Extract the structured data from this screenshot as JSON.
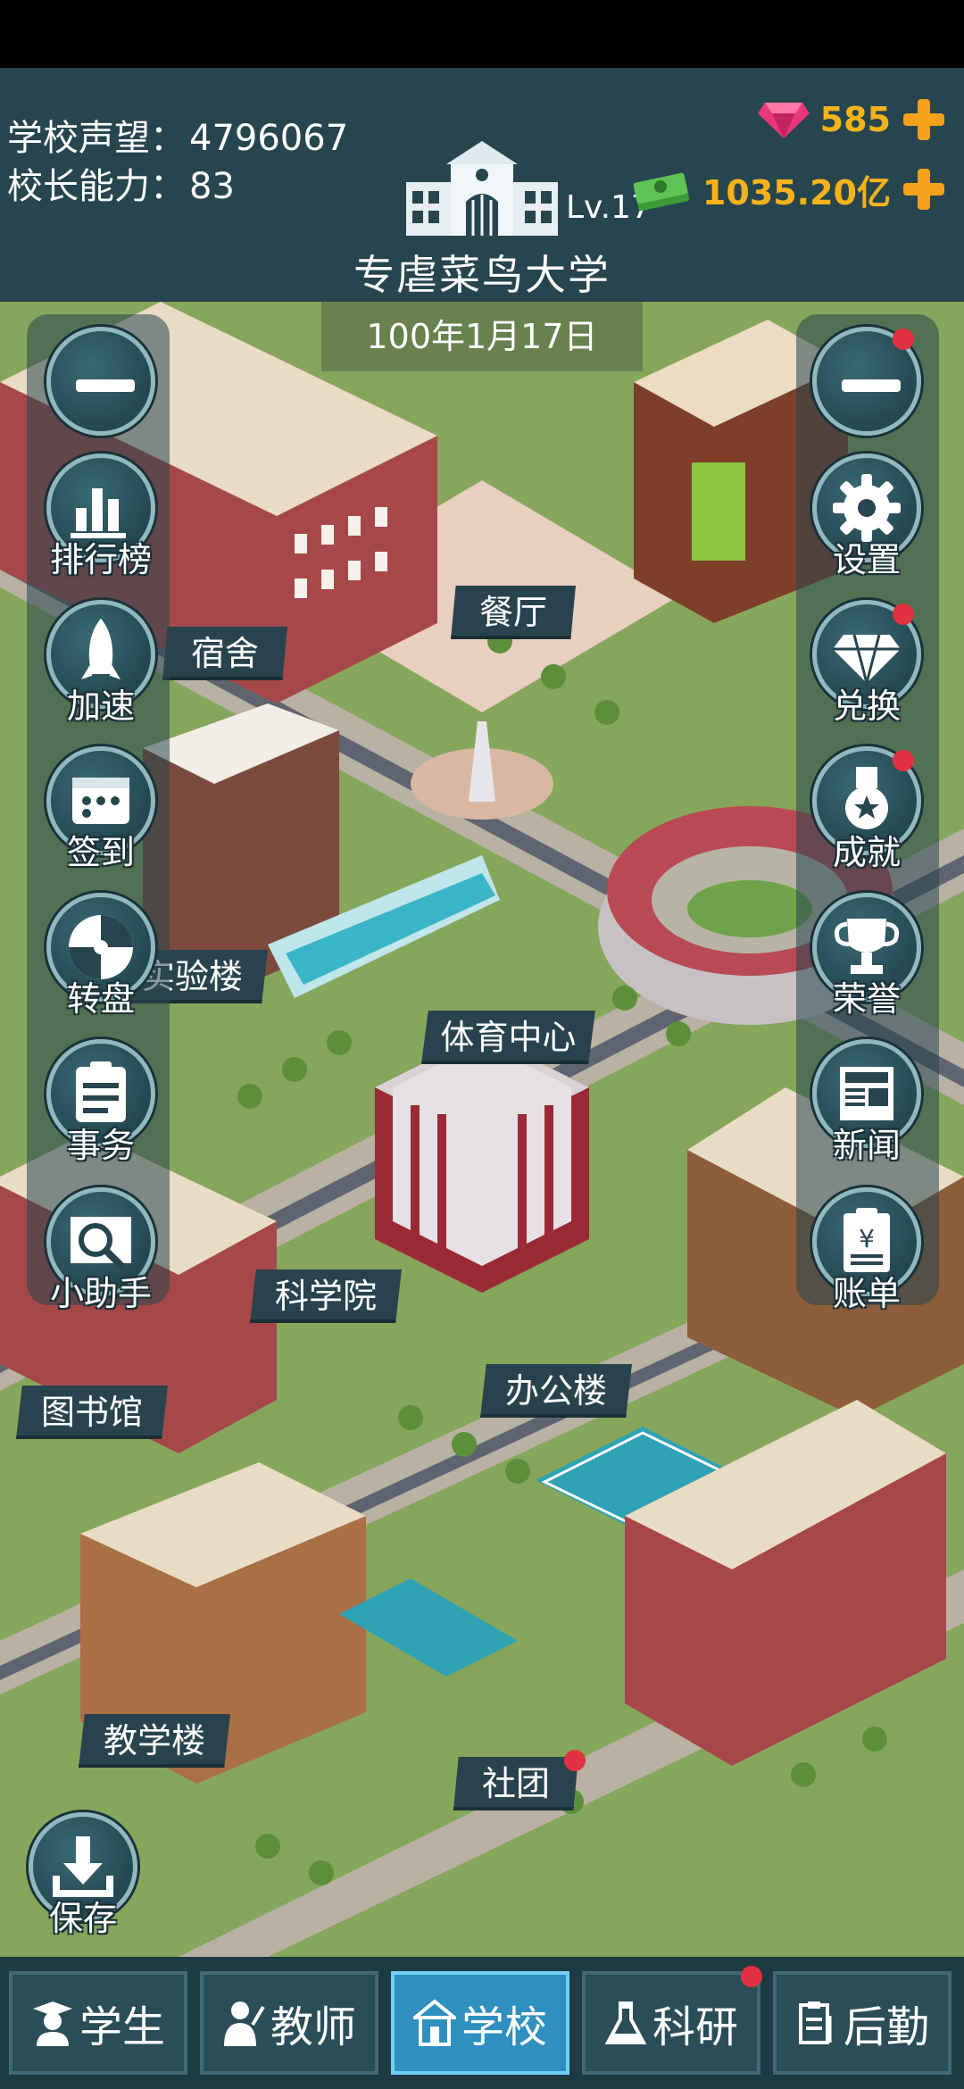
{
  "header": {
    "reputation_label": "学校声望：",
    "reputation_value": "4796067",
    "ability_label": "校长能力：",
    "ability_value": "83",
    "level": "Lv.17",
    "school_name": "专虐菜鸟大学",
    "gems": "585",
    "money": "1035.20亿"
  },
  "date": "100年1月17日",
  "buildings": {
    "dorm": "宿舍",
    "canteen": "餐厅",
    "lab": "实验楼",
    "sports": "体育中心",
    "science": "科学院",
    "library": "图书馆",
    "office": "办公楼",
    "teaching": "教学楼",
    "club": "社团"
  },
  "left_menu": {
    "ranking": "排行榜",
    "speed": "加速",
    "checkin": "签到",
    "wheel": "转盘",
    "affairs": "事务",
    "helper": "小助手"
  },
  "right_menu": {
    "settings": "设置",
    "exchange": "兑换",
    "achievement": "成就",
    "honor": "荣誉",
    "news": "新闻",
    "bill": "账单"
  },
  "save": "保存",
  "tabs": {
    "students": "学生",
    "teachers": "教师",
    "school": "学校",
    "research": "科研",
    "logistics": "后勤"
  },
  "colors": {
    "header_bg": "#27454f",
    "gold": "#f5b21a",
    "active_tab": "#2f8fbf",
    "badge": "#e23140",
    "grass": "#86a65c"
  }
}
